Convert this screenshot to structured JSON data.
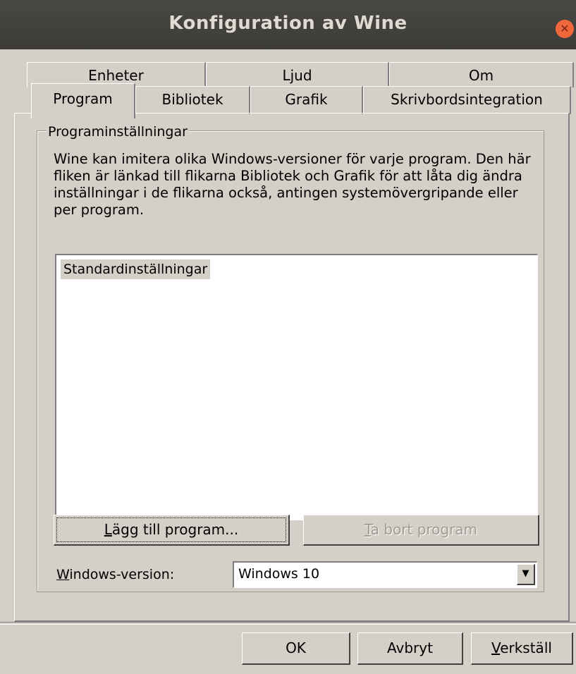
{
  "window": {
    "title": "Konfiguration av Wine"
  },
  "tabs_back": [
    "Enheter",
    "Ljud",
    "Om"
  ],
  "tabs_front": [
    "Program",
    "Bibliotek",
    "Grafik",
    "Skrivbordsintegration"
  ],
  "active_tab": "Program",
  "group": {
    "title": "Programinställningar",
    "description": "Wine kan imitera olika Windows-versioner för varje program. Den här fliken är länkad till flikarna Bibliotek och Grafik för att låta dig ändra inställningar i de flikarna också, antingen systemövergripande eller per program."
  },
  "app_list": {
    "items": [
      "Standardinställningar"
    ],
    "selected_index": 0
  },
  "buttons": {
    "add": {
      "mnemonic": "L",
      "rest": "ägg till program..."
    },
    "remove": {
      "mnemonic": "T",
      "rest": "a bort program",
      "disabled": true
    }
  },
  "version": {
    "label_mnemonic": "W",
    "label_rest": "indows-version:",
    "value": "Windows 10"
  },
  "footer": {
    "ok": "OK",
    "cancel": "Avbryt",
    "apply_mnemonic": "V",
    "apply_rest": "erkställ"
  }
}
